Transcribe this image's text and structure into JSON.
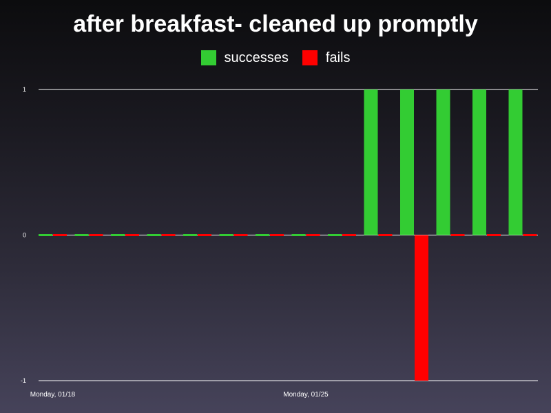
{
  "chart_data": {
    "type": "bar",
    "title": "after breakfast- cleaned up promptly",
    "xlabel": "",
    "ylabel": "",
    "ylim": [
      -1,
      1
    ],
    "yticks": [
      -1,
      0,
      1
    ],
    "grid": true,
    "legend_position": "top-center",
    "x_tick_labels": [
      "Monday, 01/18",
      "Monday, 01/25"
    ],
    "series": [
      {
        "name": "successes",
        "color": "#33cc33",
        "values": [
          0,
          0,
          0,
          0,
          0,
          0,
          0,
          0,
          0,
          1,
          1,
          1,
          1,
          1
        ]
      },
      {
        "name": "fails",
        "color": "#ff0000",
        "values": [
          0,
          0,
          0,
          0,
          0,
          0,
          0,
          0,
          0,
          0,
          -1,
          0,
          0,
          0
        ]
      }
    ]
  },
  "colors": {
    "success": "#33cc33",
    "fail": "#ff0000",
    "gridline": "#ffffff"
  }
}
